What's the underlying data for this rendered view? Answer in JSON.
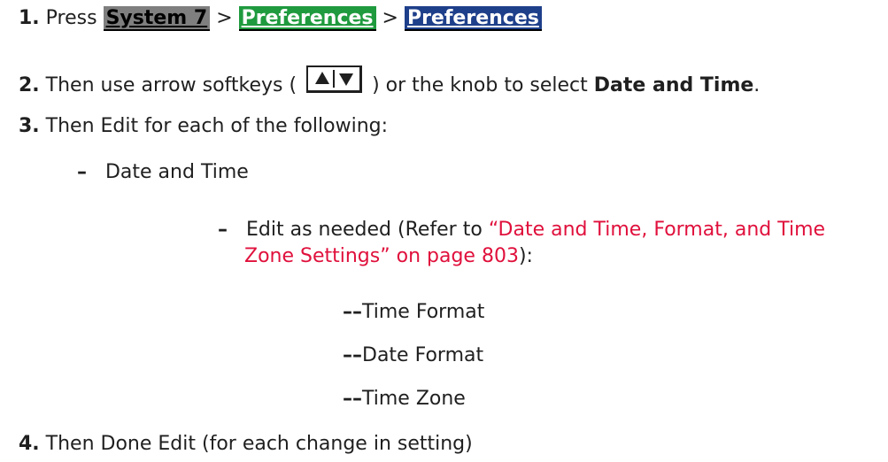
{
  "steps": [
    {
      "num": "1.",
      "press": "Press",
      "sep": ">",
      "keys": [
        "System 7",
        "Preferences",
        "Preferences"
      ]
    },
    {
      "num": "2.",
      "before": "Then use arrow softkeys (",
      "after": ") or the knob to select",
      "bold": "Date and Time",
      "end": "."
    },
    {
      "num": "3.",
      "text": "Then Edit for each of the following:"
    },
    {
      "num": "4.",
      "text": "Then Done Edit (for each change in setting)"
    }
  ],
  "sub": {
    "dash": "–",
    "item": "Date and Time",
    "edit_before": "Edit as needed (Refer to",
    "link_line1": "“Date and Time, Format, and Time",
    "link_line2": "Zone Settings” on page 803",
    "edit_after": "):",
    "subsub_dash": "––",
    "subsub": [
      "Time Format",
      "Date Format",
      "Time Zone"
    ]
  },
  "colors": {
    "system_key": "#7f7f7f",
    "preferences_green": "#1f9a3e",
    "preferences_blue": "#1e3f8a",
    "link": "#e0103c"
  }
}
